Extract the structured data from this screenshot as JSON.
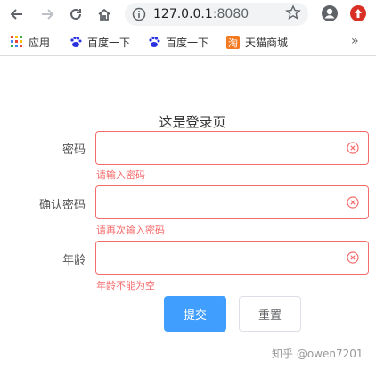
{
  "browser": {
    "url_host": "127.0.0.1",
    "url_port": ":8080"
  },
  "bookmarks": [
    {
      "label": "应用",
      "icon": "apps-grid-icon"
    },
    {
      "label": "百度一下",
      "icon": "baidu-paw-icon"
    },
    {
      "label": "百度一下",
      "icon": "baidu-paw-icon"
    },
    {
      "label": "天猫商城",
      "icon": "tmall-icon"
    }
  ],
  "bookmarks_more": "»",
  "form": {
    "title": "这是登录页",
    "fields": [
      {
        "label": "密码",
        "value": "",
        "error": "请输入密码"
      },
      {
        "label": "确认密码",
        "value": "",
        "error": "请再次输入密码"
      },
      {
        "label": "年龄",
        "value": "",
        "error": "年龄不能为空"
      }
    ],
    "submit_label": "提交",
    "reset_label": "重置"
  },
  "watermark": "知乎 @owen7201",
  "colors": {
    "error": "#f56c6c",
    "primary": "#409eff"
  }
}
